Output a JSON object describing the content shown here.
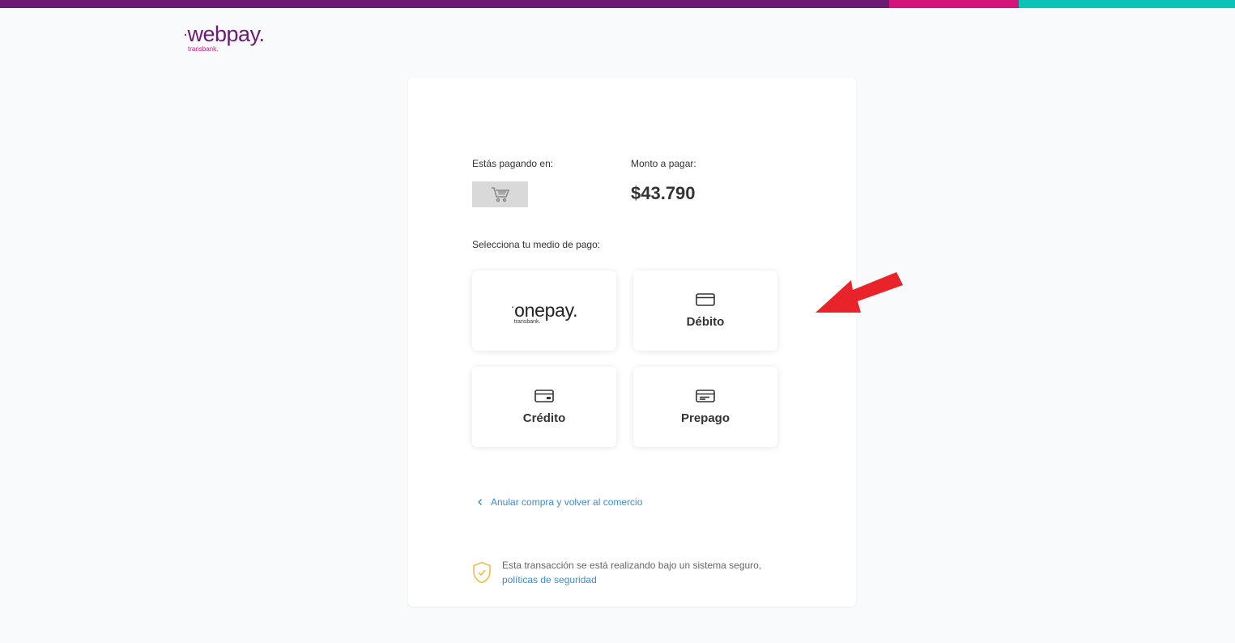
{
  "header": {
    "brand": "webpay.",
    "brand_sub": "transbank.",
    "colors": {
      "purple": "#6b1b74",
      "magenta": "#d5147b",
      "teal": "#0cc3b8"
    }
  },
  "payment": {
    "paying_at_label": "Estás pagando en:",
    "merchant_icon": "shopping-cart-icon",
    "amount_label": "Monto a pagar:",
    "amount": "$43.790",
    "select_method_label": "Selecciona tu medio de pago:"
  },
  "methods": [
    {
      "label": "",
      "logo": "onepay.",
      "logo_sub": "transbank.",
      "icon": "onepay-logo"
    },
    {
      "label": "Débito",
      "icon": "debit-card-icon"
    },
    {
      "label": "Crédito",
      "icon": "credit-card-icon"
    },
    {
      "label": "Prepago",
      "icon": "prepaid-card-icon"
    }
  ],
  "cancel_link": "Anular compra y volver al comercio",
  "security": {
    "text": "Esta transacción se está realizando bajo un sistema seguro,",
    "link": "políticas de seguridad",
    "icon": "shield-check-icon"
  },
  "annotation": {
    "icon": "red-arrow-icon",
    "color": "#e8242a"
  }
}
